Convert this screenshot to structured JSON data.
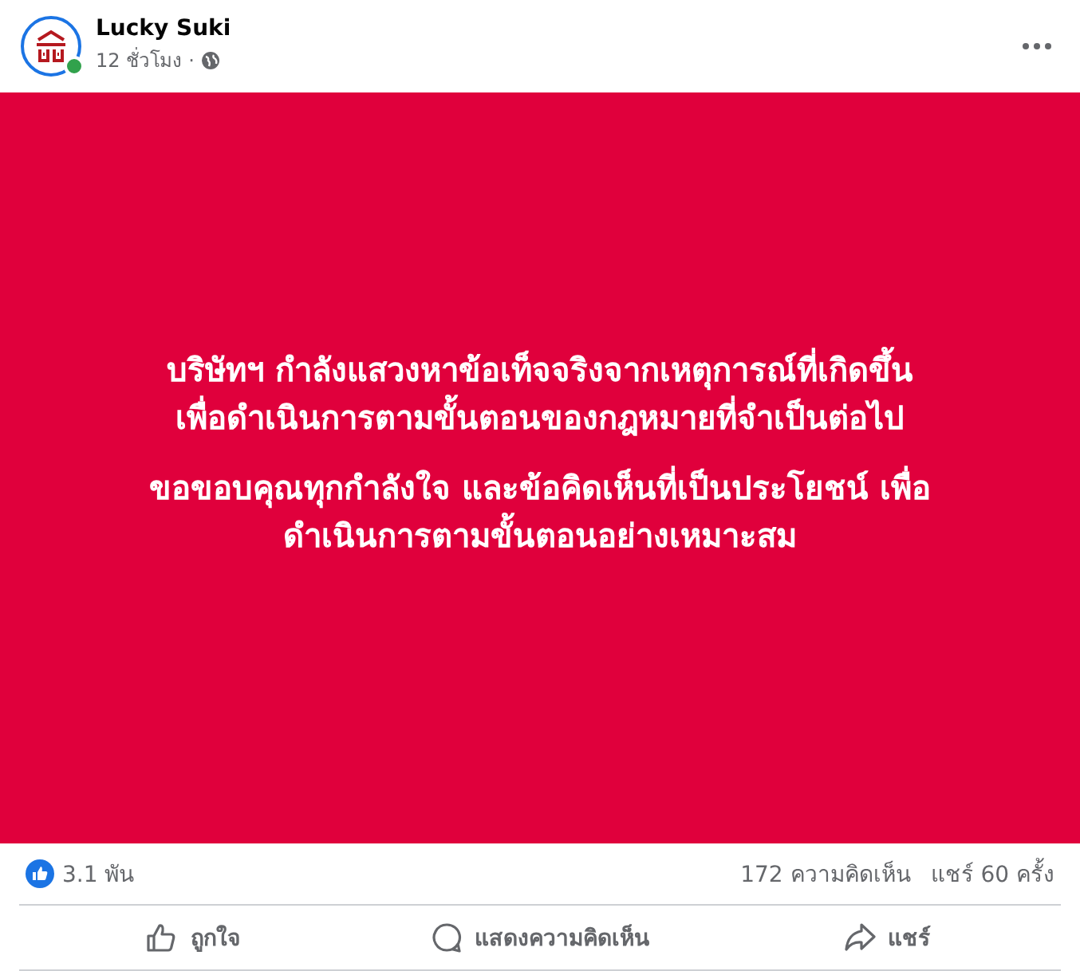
{
  "post": {
    "author": "Lucky Suki",
    "time": "12 ชั่วโมง",
    "separator": "·",
    "online": true
  },
  "image": {
    "paragraphs": [
      [
        "บริษัทฯ กำลังแสวงหาข้อเท็จจริงจากเหตุการณ์ที่เกิดขึ้น",
        "เพื่อดำเนินการตามขั้นตอนของกฎหมายที่จำเป็นต่อไป"
      ],
      [
        "ขอขอบคุณทุกกำลังใจ และข้อคิดเห็นที่เป็นประโยชน์ เพื่อ",
        "ดำเนินการตามขั้นตอนอย่างเหมาะสม"
      ]
    ]
  },
  "stats": {
    "reactions": "3.1 พัน",
    "comments": "172 ความคิดเห็น",
    "shares": "แชร์ 60 ครั้ง"
  },
  "actions": [
    {
      "kind": "like",
      "label": "ถูกใจ"
    },
    {
      "kind": "comment",
      "label": "แสดงความคิดเห็น"
    },
    {
      "kind": "share",
      "label": "แชร์"
    }
  ]
}
